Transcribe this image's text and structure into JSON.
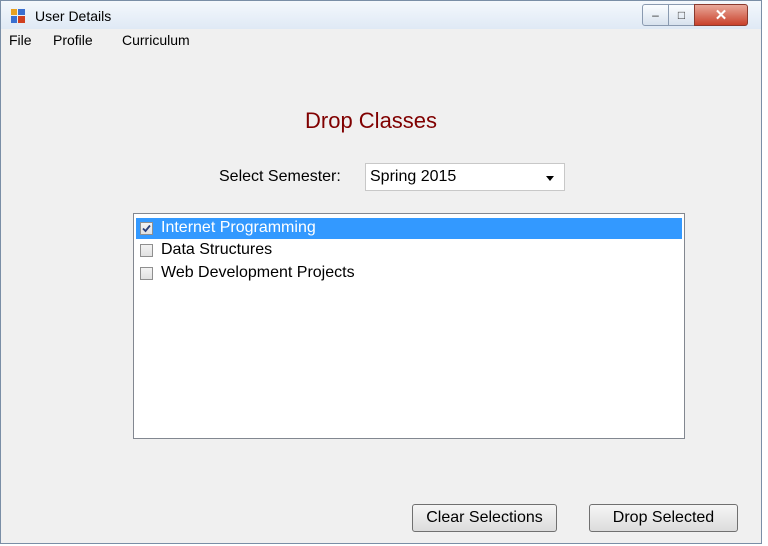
{
  "window": {
    "title": "User Details",
    "controls": {
      "minimize": "–",
      "maximize": "□",
      "close": "✕"
    }
  },
  "menu": [
    {
      "label": "File"
    },
    {
      "label": "Profile"
    },
    {
      "label": "Curriculum"
    }
  ],
  "form": {
    "heading": "Drop Classes",
    "semester_label": "Select Semester:",
    "semester_value": "Spring 2015"
  },
  "classes": [
    {
      "label": "Internet Programming",
      "checked": true,
      "selected": true
    },
    {
      "label": "Data Structures",
      "checked": false,
      "selected": false
    },
    {
      "label": "Web Development Projects",
      "checked": false,
      "selected": false
    }
  ],
  "buttons": {
    "clear": "Clear Selections",
    "drop": "Drop Selected"
  },
  "colors": {
    "heading": "#800000",
    "selection": "#3399ff",
    "close_button": "#c9412b"
  },
  "icons": {
    "app": "app-window-icon",
    "checkmark": "checkmark-icon",
    "dropdown": "chevron-down-icon"
  }
}
